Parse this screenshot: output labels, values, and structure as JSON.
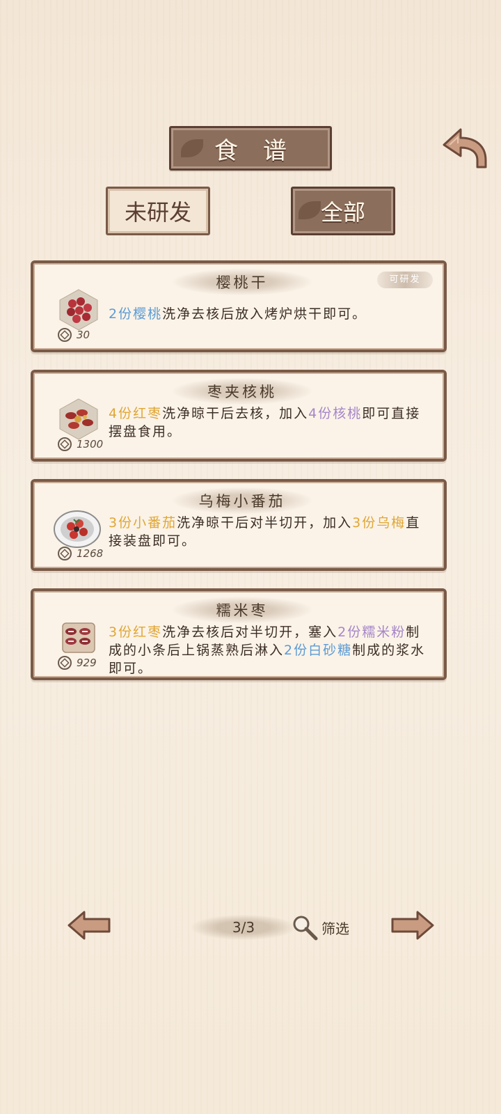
{
  "header": {
    "title": "食谱",
    "back_icon": "back-arrow-icon"
  },
  "tabs": [
    {
      "label": "未研发",
      "active": false
    },
    {
      "label": "全部",
      "active": true
    }
  ],
  "recipes": [
    {
      "name": "樱桃干",
      "badge": "可研发",
      "price": "30",
      "desc": [
        {
          "t": "2份樱桃",
          "c": "blue"
        },
        {
          "t": "洗净去核后放入烤炉烘干即可。",
          "c": ""
        }
      ]
    },
    {
      "name": "枣夹核桃",
      "price": "1300",
      "desc": [
        {
          "t": "4份红枣",
          "c": "orange"
        },
        {
          "t": "洗净晾干后去核，加入",
          "c": ""
        },
        {
          "t": "4份核桃",
          "c": "purple"
        },
        {
          "t": "即可直接摆盘食用。",
          "c": ""
        }
      ]
    },
    {
      "name": "乌梅小番茄",
      "price": "1268",
      "desc": [
        {
          "t": "3份小番茄",
          "c": "orange"
        },
        {
          "t": "洗净晾干后对半切开，加入",
          "c": ""
        },
        {
          "t": "3份乌梅",
          "c": "orange"
        },
        {
          "t": "直接装盘即可。",
          "c": ""
        }
      ]
    },
    {
      "name": "糯米枣",
      "price": "929",
      "desc": [
        {
          "t": "3份红枣",
          "c": "orange"
        },
        {
          "t": "洗净去核后对半切开，塞入",
          "c": ""
        },
        {
          "t": "2份糯米粉",
          "c": "purple"
        },
        {
          "t": "制成的小条后上锅蒸熟后淋入",
          "c": ""
        },
        {
          "t": "2份白砂糖",
          "c": "blue"
        },
        {
          "t": "制成的浆水即可。",
          "c": ""
        }
      ]
    }
  ],
  "pagination": {
    "page": "3/3",
    "filter_label": "筛选"
  },
  "colors": {
    "blue": "#5b9bd5",
    "orange": "#e0a634",
    "purple": "#a585c9",
    "frame": "#7a5a47",
    "plaque": "#8b6e5b"
  }
}
